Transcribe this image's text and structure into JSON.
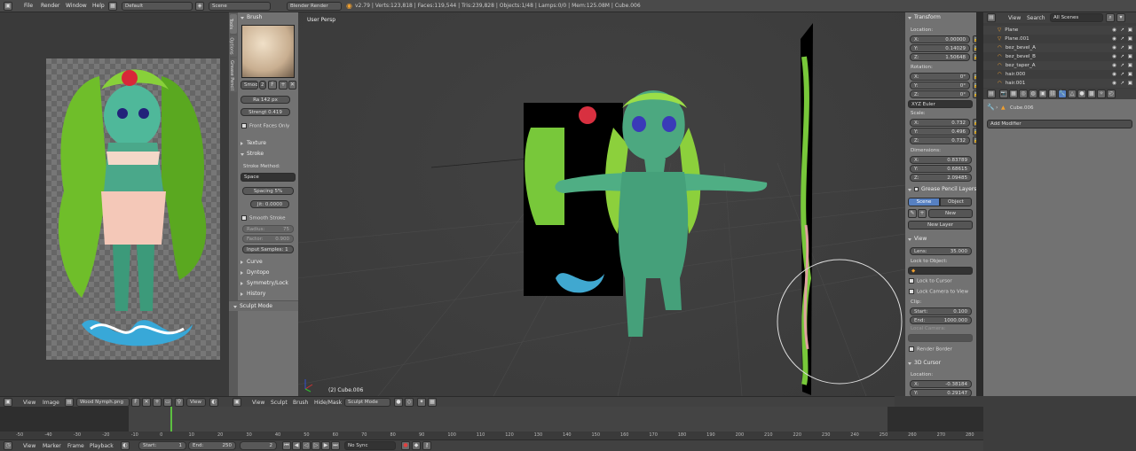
{
  "top": {
    "menus": [
      "File",
      "Render",
      "Window",
      "Help"
    ],
    "layout": "Default",
    "scene": "Scene",
    "engine": "Blender Render",
    "stats": "v2.79 | Verts:123,818 | Faces:119,544 | Tris:239,828 | Objects:1/48 | Lamps:0/0 | Mem:125.08M | Cube.006"
  },
  "tool_panel": {
    "tabs": [
      "Tools",
      "Options",
      "Grease Pencil"
    ],
    "brush_header": "Brush",
    "smooth_name": "Smoo",
    "smooth_users": "2",
    "radius": "Ra 142 px",
    "strength": "Strengt 0.419",
    "front_faces": "Front Faces Only",
    "texture": "Texture",
    "stroke": "Stroke",
    "stroke_method_label": "Stroke Method:",
    "stroke_method": "Space",
    "spacing": "Spacing  5%",
    "jitter": "Jit: 0.0000",
    "smooth_stroke": "Smooth Stroke",
    "radius2": "Radius:",
    "radius2_val": "75",
    "factor": "Factor:",
    "factor_val": "0.900",
    "input_samples": "Input Samples:  1",
    "curve": "Curve",
    "dyntopo": "Dyntopo",
    "symmetry": "Symmetry/Lock",
    "history": "History",
    "sculpt_mode": "Sculpt Mode"
  },
  "viewport": {
    "label": "User Persp",
    "object": "(2) Cube.006",
    "menus": [
      "View",
      "Sculpt",
      "Brush",
      "Hide/Mask"
    ],
    "mode": "Sculpt Mode"
  },
  "image_editor": {
    "menus": [
      "View",
      "Image"
    ],
    "image": "Wood Nymph.png",
    "view": "View"
  },
  "properties": {
    "transform": "Transform",
    "location": "Location:",
    "loc": [
      {
        "a": "X:",
        "v": "0.00000"
      },
      {
        "a": "Y:",
        "v": "0.14029"
      },
      {
        "a": "Z:",
        "v": "1.50648"
      }
    ],
    "rotation": "Rotation:",
    "rot": [
      {
        "a": "X:",
        "v": "0°"
      },
      {
        "a": "Y:",
        "v": "0°"
      },
      {
        "a": "Z:",
        "v": "0°"
      }
    ],
    "euler": "XYZ Euler",
    "scale": "Scale:",
    "scl": [
      {
        "a": "X:",
        "v": "0.732"
      },
      {
        "a": "Y:",
        "v": "0.496"
      },
      {
        "a": "Z:",
        "v": "0.732"
      }
    ],
    "dimensions": "Dimensions:",
    "dim": [
      {
        "a": "X:",
        "v": "0.83789"
      },
      {
        "a": "Y:",
        "v": "0.68615"
      },
      {
        "a": "Z:",
        "v": "2.09485"
      }
    ],
    "gp_layers": "Grease Pencil Layers",
    "gp_scene": "Scene",
    "gp_object": "Object",
    "gp_new": "New",
    "gp_new_layer": "New Layer",
    "view": "View",
    "lens": "Lens:",
    "lens_val": "35.000",
    "lock_object": "Lock to Object:",
    "lock_cursor": "Lock to Cursor",
    "lock_camera": "Lock Camera to View",
    "clip": "Clip:",
    "clip_start": "Start:",
    "clip_start_val": "0.100",
    "clip_end": "End:",
    "clip_end_val": "1000.000",
    "local_camera": "Local Camera:",
    "render_border": "Render Border",
    "cursor3d": "3D Cursor",
    "cursor_loc": "Location:",
    "cur": [
      {
        "a": "X:",
        "v": "-0.38184"
      },
      {
        "a": "Y:",
        "v": "0.29147"
      }
    ]
  },
  "outliner": {
    "menus": [
      "View",
      "Search"
    ],
    "filter": "All Scenes",
    "items": [
      "Plane",
      "Plane.001",
      "bez_bevel_A",
      "bez_bevel_B",
      "bez_taper_A",
      "hair.000",
      "hair.001"
    ]
  },
  "modifiers": {
    "object": "Cube.006",
    "add": "Add Modifier"
  },
  "timeline": {
    "menus": [
      "View",
      "Marker",
      "Frame",
      "Playback"
    ],
    "start": "Start:",
    "start_val": "1",
    "end": "End:",
    "end_val": "250",
    "current": "2",
    "sync": "No Sync",
    "ticks": [
      "-50",
      "-40",
      "-20",
      "0",
      "20",
      "40",
      "60",
      "80",
      "100",
      "120",
      "140",
      "160",
      "180",
      "200",
      "220",
      "240",
      "260",
      "280"
    ],
    "ruler": [
      "-50",
      "-40",
      "-30",
      "-20",
      "-10",
      "0",
      "10",
      "20",
      "30",
      "40",
      "50",
      "60",
      "70",
      "80",
      "90",
      "100",
      "110",
      "120",
      "130",
      "140",
      "150",
      "160",
      "170",
      "180",
      "190",
      "200",
      "210",
      "220",
      "230",
      "240",
      "250",
      "260",
      "270",
      "280"
    ]
  }
}
